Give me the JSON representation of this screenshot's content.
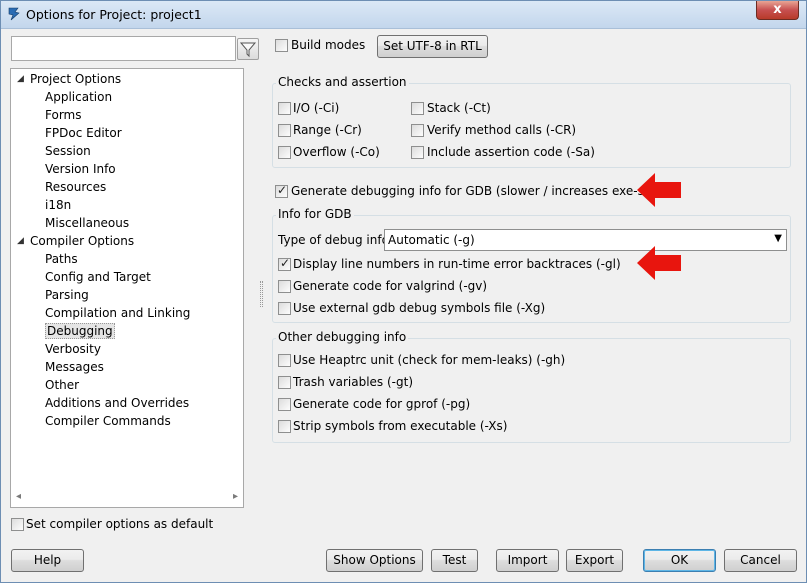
{
  "window": {
    "title": "Options for Project: project1",
    "close_label": "x"
  },
  "sidebar": {
    "search": {
      "value": "",
      "placeholder": ""
    },
    "tree": [
      {
        "label": "Project Options",
        "level": 0,
        "expanded": true
      },
      {
        "label": "Application",
        "level": 1
      },
      {
        "label": "Forms",
        "level": 1
      },
      {
        "label": "FPDoc Editor",
        "level": 1
      },
      {
        "label": "Session",
        "level": 1
      },
      {
        "label": "Version Info",
        "level": 1
      },
      {
        "label": "Resources",
        "level": 1
      },
      {
        "label": "i18n",
        "level": 1
      },
      {
        "label": "Miscellaneous",
        "level": 1
      },
      {
        "label": "Compiler Options",
        "level": 0,
        "expanded": true
      },
      {
        "label": "Paths",
        "level": 1
      },
      {
        "label": "Config and Target",
        "level": 1
      },
      {
        "label": "Parsing",
        "level": 1
      },
      {
        "label": "Compilation and Linking",
        "level": 1
      },
      {
        "label": "Debugging",
        "level": 1,
        "selected": true
      },
      {
        "label": "Verbosity",
        "level": 1
      },
      {
        "label": "Messages",
        "level": 1
      },
      {
        "label": "Other",
        "level": 1
      },
      {
        "label": "Additions and Overrides",
        "level": 1
      },
      {
        "label": "Compiler Commands",
        "level": 1
      }
    ],
    "set_default_label": "Set compiler options as default",
    "set_default_checked": false
  },
  "top": {
    "build_modes_label": "Build modes",
    "build_modes_checked": false,
    "utf8_button_label": "Set UTF-8 in RTL"
  },
  "checks": {
    "title": "Checks and assertion",
    "io": {
      "label": "I/O (-Ci)",
      "checked": false
    },
    "range": {
      "label": "Range (-Cr)",
      "checked": false
    },
    "overflow": {
      "label": "Overflow (-Co)",
      "checked": false
    },
    "stack": {
      "label": "Stack (-Ct)",
      "checked": false
    },
    "verify": {
      "label": "Verify method calls (-CR)",
      "checked": false
    },
    "assertion": {
      "label": "Include assertion code (-Sa)",
      "checked": false
    }
  },
  "gdb": {
    "generate_label": "Generate debugging info for GDB (slower / increases exe-size)",
    "generate_checked": true,
    "info_title": "Info for GDB",
    "type_label": "Type of debug info",
    "type_value": "Automatic (-g)",
    "line_numbers": {
      "label": "Display line numbers in run-time error backtraces (-gl)",
      "checked": true
    },
    "valgrind": {
      "label": "Generate code for valgrind (-gv)",
      "checked": false
    },
    "external": {
      "label": "Use external gdb debug symbols file (-Xg)",
      "checked": false
    }
  },
  "other": {
    "title": "Other debugging info",
    "heaptrc": {
      "label": "Use Heaptrc unit (check for mem-leaks) (-gh)",
      "checked": false
    },
    "trash": {
      "label": "Trash variables (-gt)",
      "checked": false
    },
    "gprof": {
      "label": "Generate code for gprof (-pg)",
      "checked": false
    },
    "strip": {
      "label": "Strip symbols from executable (-Xs)",
      "checked": false
    }
  },
  "buttons": {
    "help": "Help",
    "show_options": "Show Options",
    "test": "Test",
    "import": "Import",
    "export": "Export",
    "ok": "OK",
    "cancel": "Cancel"
  },
  "colors": {
    "annotation_arrow": "#e8150e",
    "titlebar": "#dbe8f6",
    "default_button_border": "#3c7fb1"
  }
}
